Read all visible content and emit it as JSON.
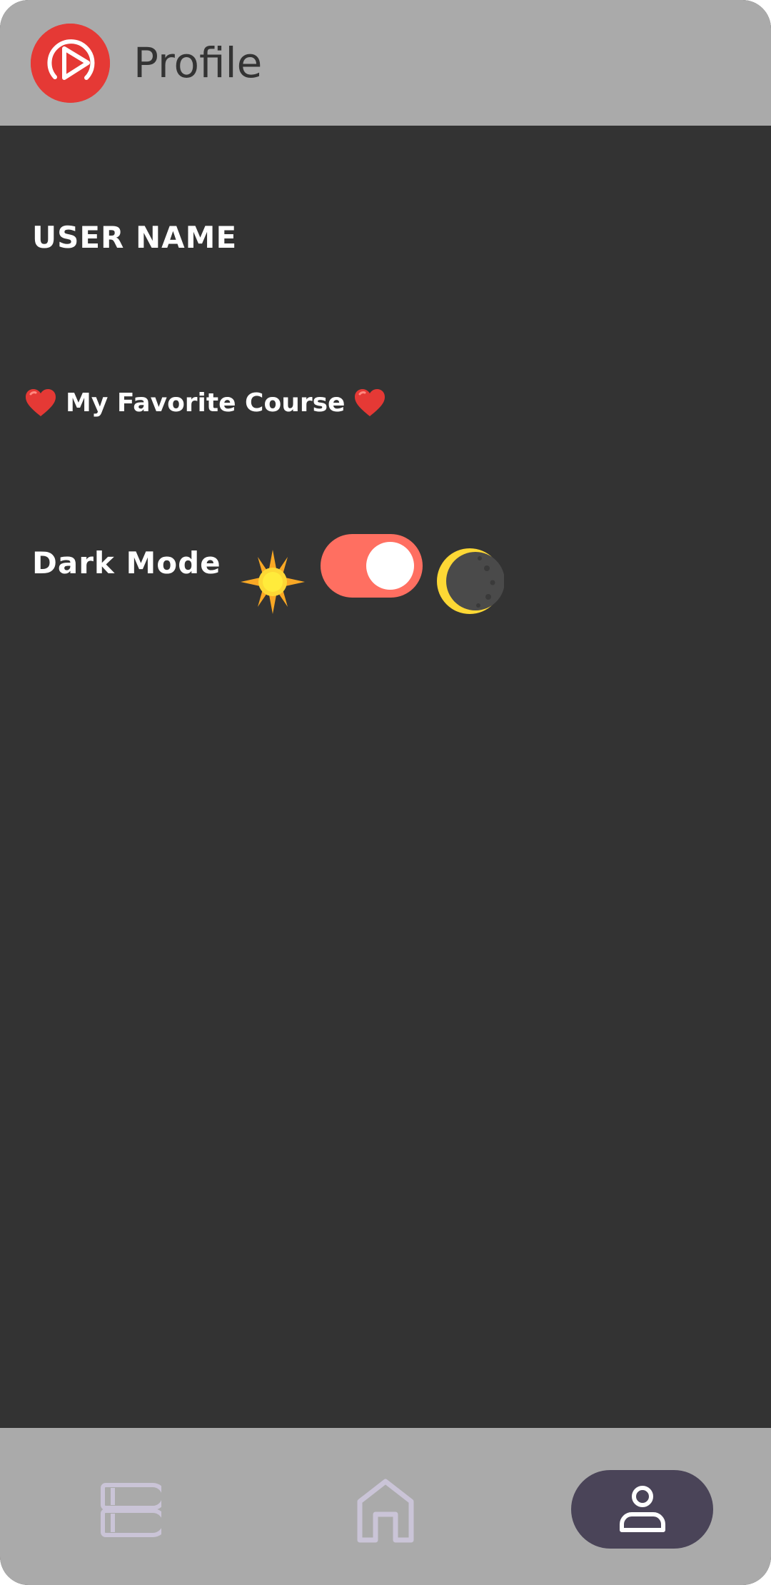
{
  "app_bar": {
    "title": "Profile",
    "logo_icon": "play-logo-icon",
    "logo_color": "#e53935"
  },
  "profile": {
    "username": "USER NAME",
    "favorite_course_label": "My Favorite Course",
    "favorite_icon": "heart-icon",
    "dark_mode_label": "Dark Mode",
    "dark_mode_enabled": true,
    "toggle_color": "#ff6f61",
    "light_icon": "sun-icon",
    "dark_icon": "moon-icon"
  },
  "bottom_nav": {
    "items": [
      {
        "name": "courses",
        "icon": "books-icon",
        "selected": false
      },
      {
        "name": "home",
        "icon": "home-icon",
        "selected": false
      },
      {
        "name": "profile",
        "icon": "person-icon",
        "selected": true
      }
    ],
    "selected_bg": "#4a4458",
    "icon_color": "#cac4d7"
  },
  "colors": {
    "appbar_bg": "#aaaaaa",
    "content_bg": "#333333",
    "text": "#ffffff"
  }
}
